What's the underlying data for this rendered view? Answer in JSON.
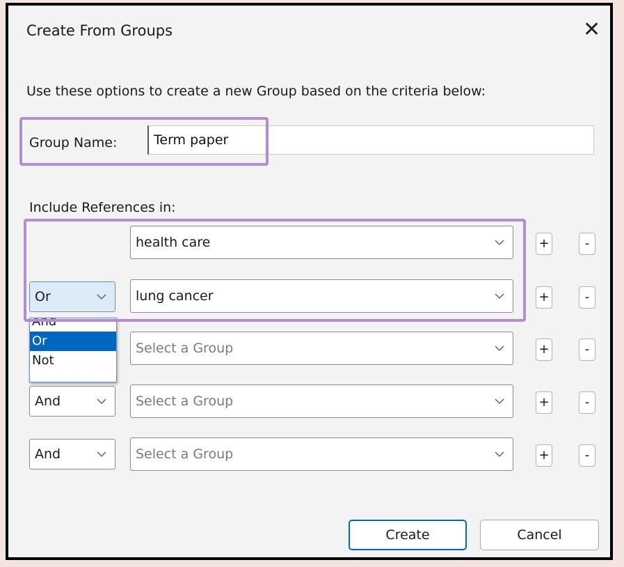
{
  "dialog": {
    "title": "Create From Groups",
    "close_glyph": "✕",
    "description": "Use these options to create a new Group based on the criteria below:",
    "group_name_label": "Group Name:",
    "group_name_value": "Term paper",
    "include_label": "Include References in:"
  },
  "rows": [
    {
      "operator": "",
      "group": "health care"
    },
    {
      "operator": "Or",
      "group": "lung cancer"
    },
    {
      "operator": "",
      "group": "Select a Group"
    },
    {
      "operator": "And",
      "group": "Select a Group"
    },
    {
      "operator": "And",
      "group": "Select a Group"
    }
  ],
  "row_buttons": {
    "add": "+",
    "remove": "-"
  },
  "operator_menu": {
    "options": [
      "And",
      "Or",
      "Not"
    ],
    "selected": "Or"
  },
  "footer": {
    "create_label": "Create",
    "cancel_label": "Cancel"
  },
  "colors": {
    "highlight": "#b08ed0",
    "selection": "#0067c0",
    "accent_border": "#0067c0"
  }
}
